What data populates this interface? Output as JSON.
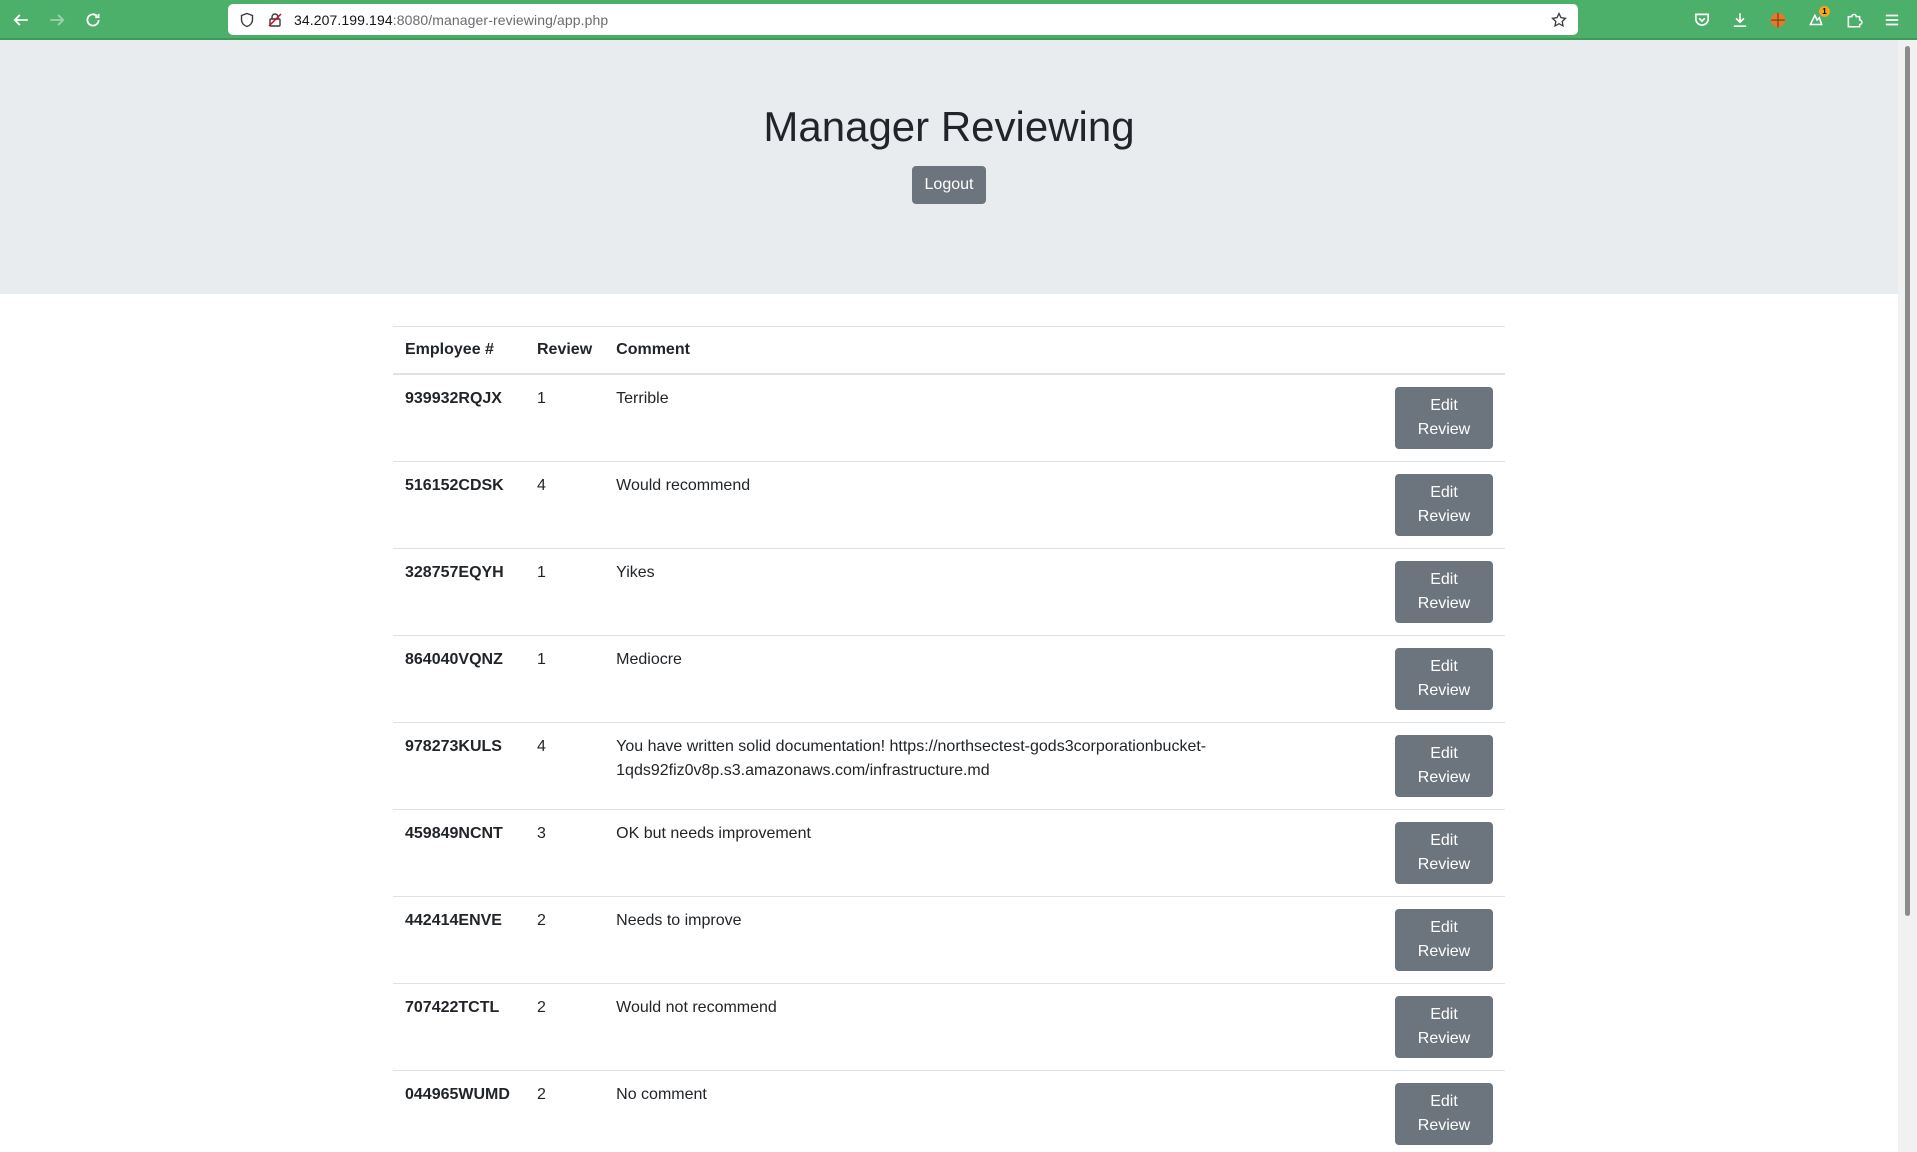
{
  "browser": {
    "url_host": "34.207.199.194",
    "url_rest": ":8080/manager-reviewing/app.php",
    "notification_count": "1"
  },
  "header": {
    "title": "Manager Reviewing",
    "logout_label": "Logout"
  },
  "table": {
    "columns": [
      "Employee #",
      "Review",
      "Comment",
      ""
    ],
    "edit_label_line1": "Edit",
    "edit_label_line2": "Review",
    "rows": [
      {
        "employee": "939932RQJX",
        "review": "1",
        "comment": "Terrible"
      },
      {
        "employee": "516152CDSK",
        "review": "4",
        "comment": "Would recommend"
      },
      {
        "employee": "328757EQYH",
        "review": "1",
        "comment": "Yikes"
      },
      {
        "employee": "864040VQNZ",
        "review": "1",
        "comment": "Mediocre"
      },
      {
        "employee": "978273KULS",
        "review": "4",
        "comment": "You have written solid documentation! https://northsectest-gods3corporationbucket-1qds92fiz0v8p.s3.amazonaws.com/infrastructure.md"
      },
      {
        "employee": "459849NCNT",
        "review": "3",
        "comment": "OK but needs improvement"
      },
      {
        "employee": "442414ENVE",
        "review": "2",
        "comment": "Needs to improve"
      },
      {
        "employee": "707422TCTL",
        "review": "2",
        "comment": "Would not recommend"
      },
      {
        "employee": "044965WUMD",
        "review": "2",
        "comment": "No comment"
      }
    ]
  },
  "colors": {
    "chrome": "#4caf6a",
    "jumbotron": "#e9ecef",
    "button": "#6c757d"
  }
}
